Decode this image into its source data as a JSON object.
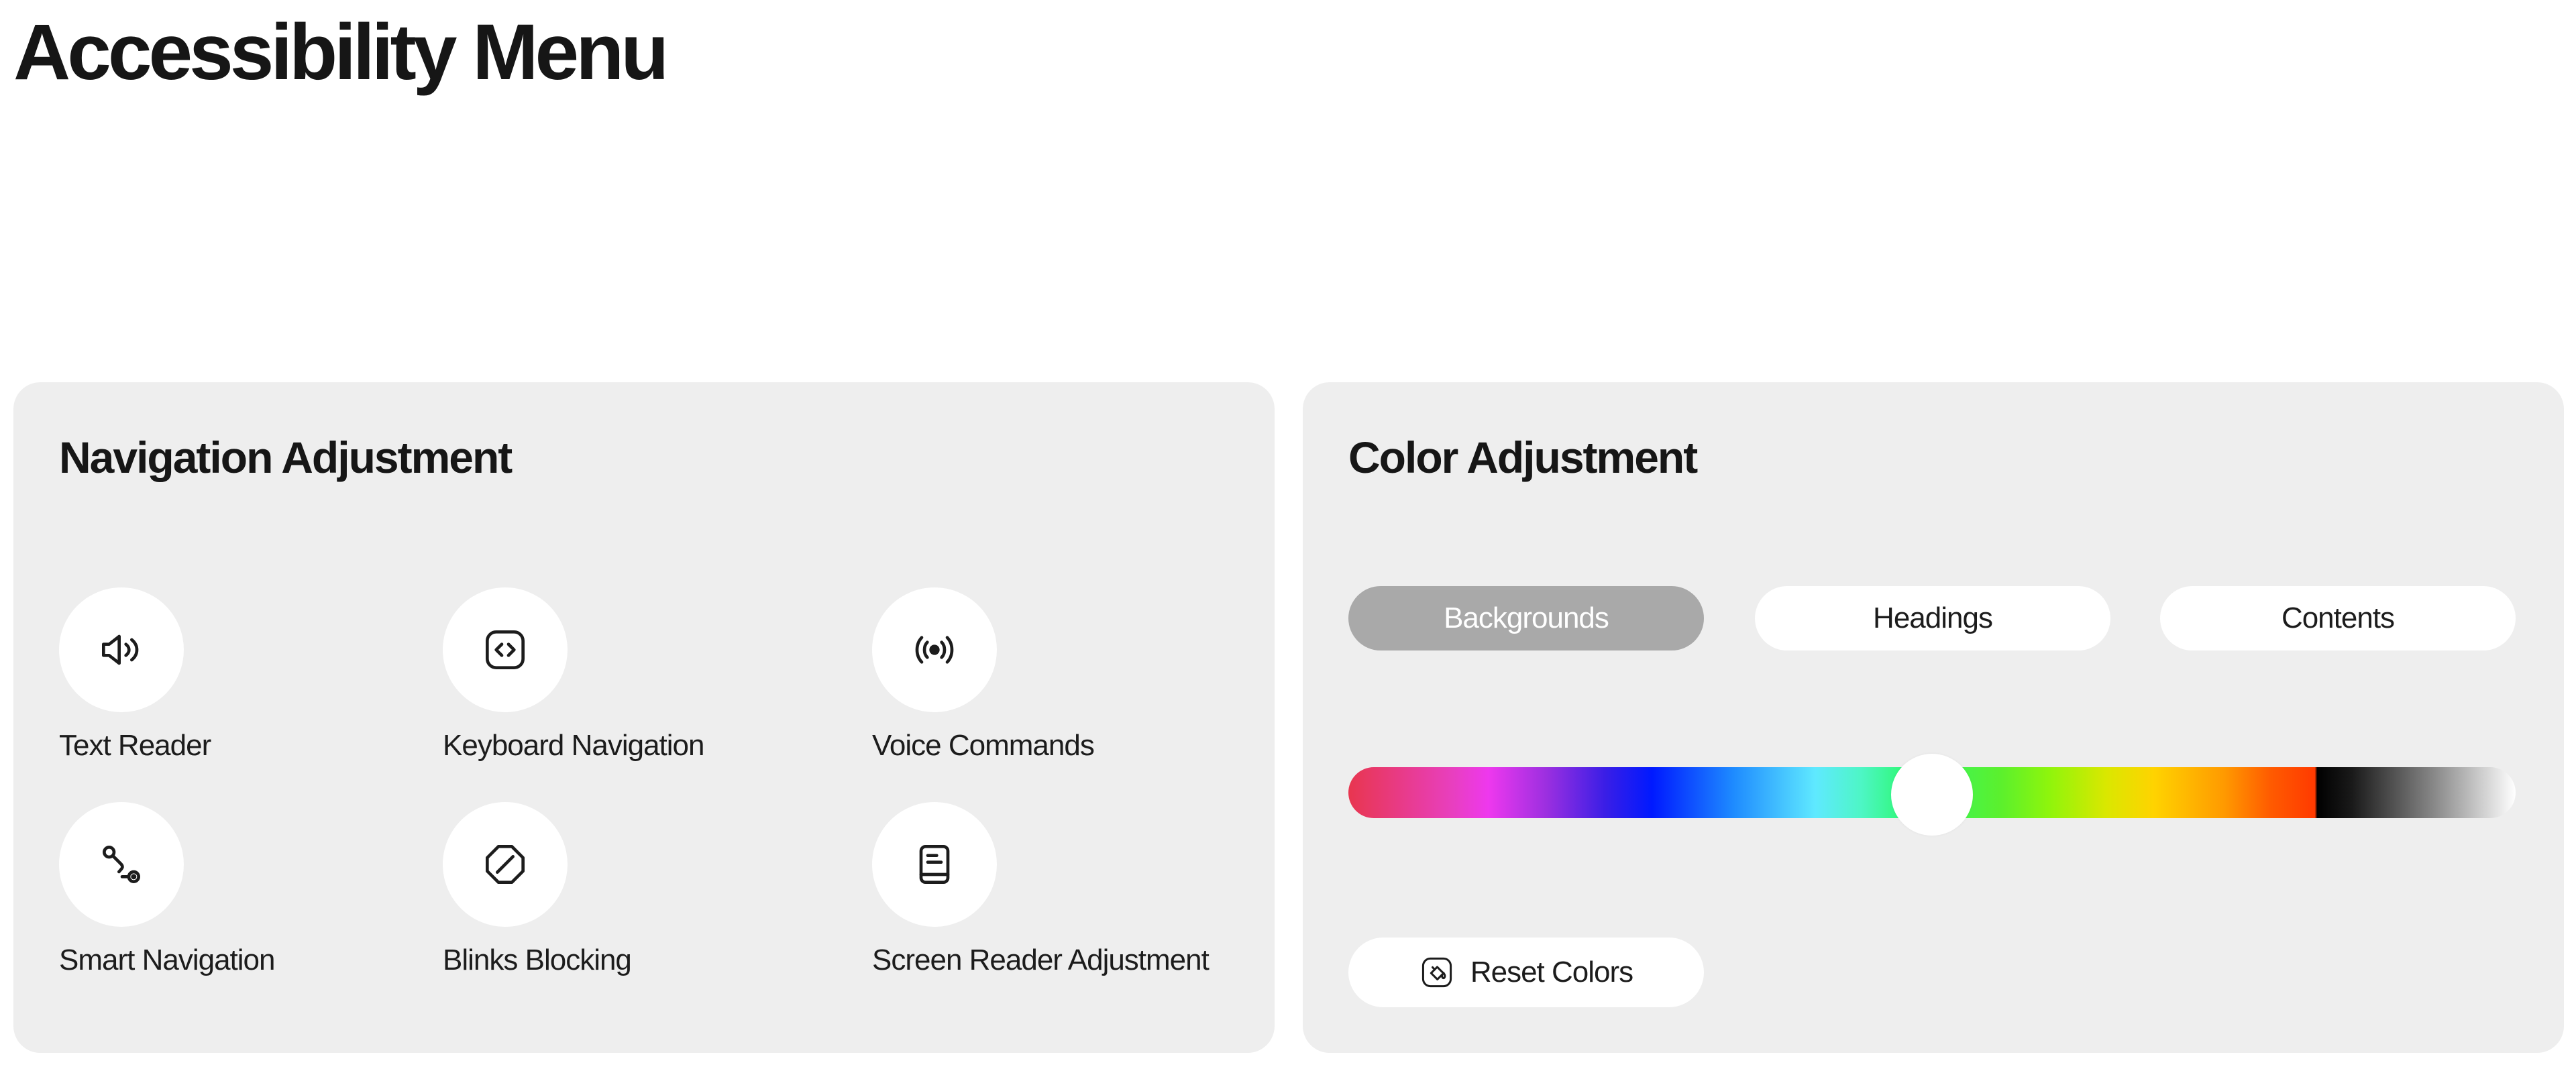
{
  "page": {
    "title": "Accessibility Menu"
  },
  "navigation_panel": {
    "title": "Navigation Adjustment",
    "items": [
      {
        "label": "Text Reader",
        "icon": "speaker-icon"
      },
      {
        "label": "Keyboard Navigation",
        "icon": "code-brackets-icon"
      },
      {
        "label": "Voice Commands",
        "icon": "broadcast-icon"
      },
      {
        "label": "Smart Navigation",
        "icon": "route-icon"
      },
      {
        "label": "Blinks Blocking",
        "icon": "block-icon"
      },
      {
        "label": "Screen Reader Adjustment",
        "icon": "document-icon"
      }
    ]
  },
  "color_panel": {
    "title": "Color Adjustment",
    "tabs": [
      {
        "label": "Backgrounds",
        "active": true
      },
      {
        "label": "Headings",
        "active": false
      },
      {
        "label": "Contents",
        "active": false
      }
    ],
    "slider": {
      "value": 0.5
    },
    "reset_label": "Reset Colors"
  },
  "colors": {
    "panel_background": "#eeeeee",
    "active_tab": "#a9a9a9",
    "text": "#161616"
  }
}
